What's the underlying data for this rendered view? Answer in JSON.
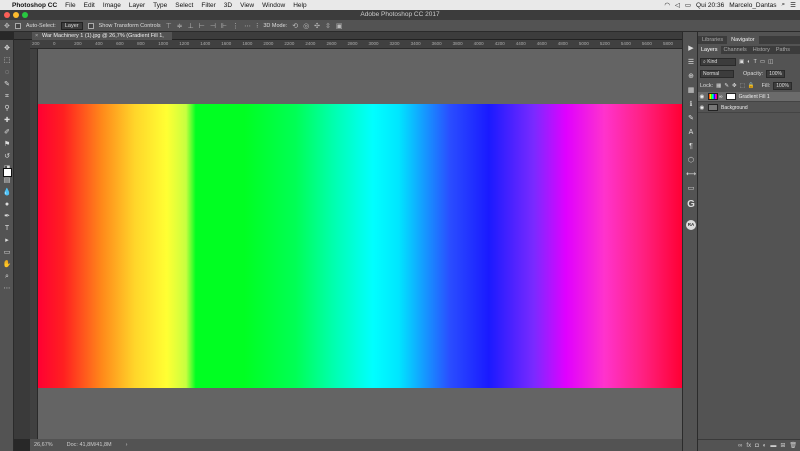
{
  "menubar": {
    "app_name": "Photoshop CC",
    "items": [
      "File",
      "Edit",
      "Image",
      "Layer",
      "Type",
      "Select",
      "Filter",
      "3D",
      "View",
      "Window",
      "Help"
    ],
    "clock": "Qui 20:36",
    "user": "Marcelo_Dantas"
  },
  "window": {
    "title": "Adobe Photoshop CC 2017"
  },
  "options_bar": {
    "auto_select_label": "Auto-Select:",
    "auto_select_value": "Layer",
    "transform_label": "Show Transform Controls",
    "mode_3d_label": "3D Mode:"
  },
  "document": {
    "tab_title": "War Machinery 1 (1).jpg @ 26,7% (Gradient Fill 1, RGB/8) *",
    "ruler_ticks": [
      "200",
      "0",
      "200",
      "400",
      "600",
      "800",
      "1000",
      "1200",
      "1400",
      "1600",
      "1800",
      "2000",
      "2200",
      "2400",
      "2600",
      "2800",
      "3000",
      "3200",
      "3400",
      "3600",
      "3800",
      "4000",
      "4200",
      "4400",
      "4600",
      "4800",
      "5000",
      "5200",
      "5400",
      "5600",
      "5800"
    ]
  },
  "status": {
    "zoom": "26,67%",
    "doc_info": "Doc: 41,8M/41,8M"
  },
  "panel": {
    "top_tabs": [
      "Libraries",
      "Navigator"
    ],
    "tabs": [
      "Layers",
      "Channels",
      "History",
      "Paths"
    ],
    "filter_kind": "Kind",
    "blend_mode": "Normal",
    "opacity_label": "Opacity:",
    "opacity_value": "100%",
    "lock_label": "Lock:",
    "fill_label": "Fill:",
    "fill_value": "100%",
    "layers": [
      {
        "name": "Gradient Fill 1"
      },
      {
        "name": "Background"
      }
    ]
  },
  "colors": {
    "accent": "#1473e6",
    "panel_bg": "#535353",
    "pasteboard": "#646464"
  }
}
